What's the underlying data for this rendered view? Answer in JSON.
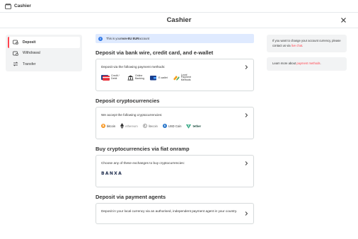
{
  "app": {
    "title": "Cashier"
  },
  "header": {
    "title": "Cashier"
  },
  "sidebar": {
    "items": [
      {
        "label": "Deposit",
        "icon": "deposit-icon",
        "active": true
      },
      {
        "label": "Withdrawal",
        "icon": "withdrawal-icon",
        "active": false
      },
      {
        "label": "Transfer",
        "icon": "transfer-icon",
        "active": false
      }
    ]
  },
  "notice": {
    "prefix": "This is your ",
    "bold": "non-EU EUR",
    "suffix": " account"
  },
  "sections": [
    {
      "title": "Deposit via bank wire, credit card, and e-wallet",
      "description": "Deposit via the following payment methods:",
      "logos": [
        {
          "label": "Credit / Debit",
          "icon": "credit-card-icon"
        },
        {
          "label": "Online Banking",
          "icon": "bank-icon"
        },
        {
          "label": "E-wallet",
          "icon": "ewallet-icon"
        },
        {
          "label": "Local Payment Methods",
          "icon": "local-payment-icon"
        }
      ]
    },
    {
      "title": "Deposit cryptocurrencies",
      "description": "We accept the following cryptocurrencies:",
      "logos": [
        {
          "label": "bitcoin",
          "icon": "bitcoin-icon"
        },
        {
          "label": "ethereum",
          "icon": "ethereum-icon"
        },
        {
          "label": "litecoin",
          "icon": "litecoin-icon"
        },
        {
          "label": "USD Coin",
          "icon": "usdcoin-icon"
        },
        {
          "label": "tether",
          "icon": "tether-icon"
        }
      ]
    },
    {
      "title": "Buy cryptocurrencies via fiat onramp",
      "description": "Choose any of these exchanges to buy cryptocurrencies:",
      "exchange": "BANXA"
    },
    {
      "title": "Deposit via payment agents",
      "description": "Deposit in your local currency via an authorised, independent payment agent in your country."
    }
  ],
  "right": {
    "box1": {
      "text": "If you want to change your account currency, please contact us via ",
      "link": "live chat",
      "end": "."
    },
    "box2": {
      "text": "Learn more about ",
      "link": "payment methods",
      "end": "."
    }
  },
  "colors": {
    "accent": "#ff444f",
    "info": "#2e77e6",
    "notice_bg": "#dfeaff",
    "panel_bg": "#f2f3f4"
  }
}
